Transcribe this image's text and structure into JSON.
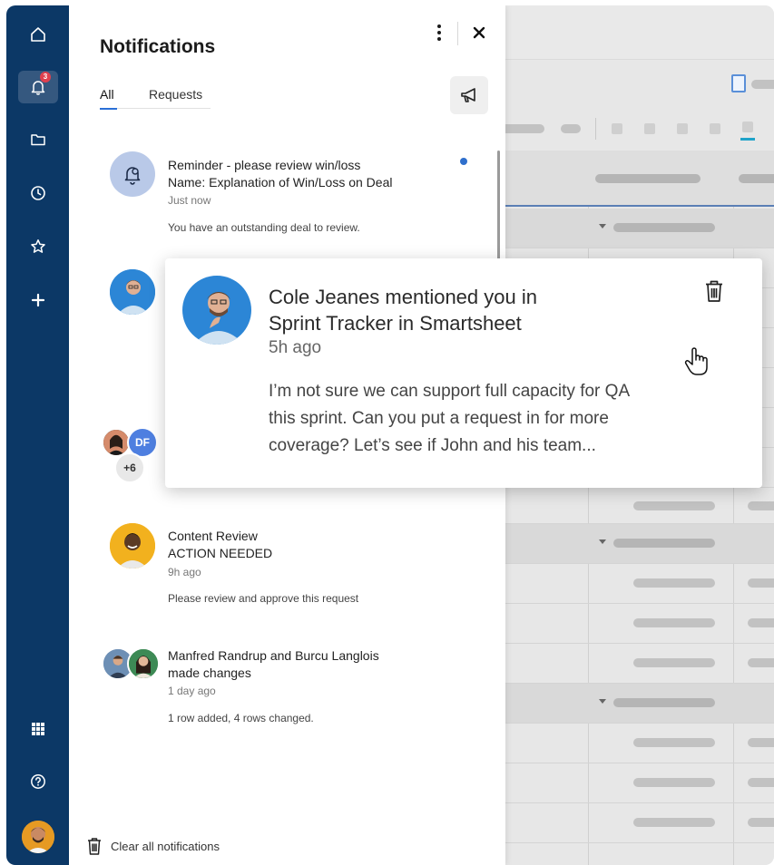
{
  "nav": {
    "items": [
      {
        "name": "home",
        "icon": "home-icon"
      },
      {
        "name": "notifications",
        "icon": "bell-icon",
        "badge": "3",
        "active": true
      },
      {
        "name": "browse",
        "icon": "folder-icon"
      },
      {
        "name": "recents",
        "icon": "clock-icon"
      },
      {
        "name": "favorites",
        "icon": "star-icon"
      },
      {
        "name": "create",
        "icon": "plus-icon"
      },
      {
        "name": "launcher",
        "icon": "grid-icon"
      },
      {
        "name": "help",
        "icon": "help-icon"
      }
    ],
    "badge_count": "3",
    "colors": {
      "rail": "#0c3866",
      "active": "#35587f",
      "badge": "#e0414f"
    }
  },
  "panel": {
    "title": "Notifications",
    "tabs": [
      {
        "label": "All",
        "active": true
      },
      {
        "label": "Requests",
        "active": false
      }
    ],
    "notifications": [
      {
        "title_line1": "Reminder - please review win/loss",
        "title_line2": "Name: Explanation of Win/Loss on Deal",
        "time": "Just now",
        "body": "You have an outstanding deal to review.",
        "unread": true,
        "icon": "reminder-bell-icon"
      },
      {
        "title_line1": "Content Review",
        "title_line2": "ACTION NEEDED",
        "time": "9h ago",
        "body": "Please review and approve this request"
      },
      {
        "title_line1": "Manfred Randrup and Burcu Langlois",
        "title_line2": "made changes",
        "time": "1 day ago",
        "body": "1 row added, 4 rows changed."
      }
    ],
    "group_avatar": {
      "initials": "DF",
      "more": "+6"
    },
    "clear_all": "Clear all notifications"
  },
  "hover_card": {
    "title_line1": "Cole Jeanes mentioned you in",
    "title_line2": "Sprint Tracker in Smartsheet",
    "time": "5h ago",
    "body_line1": "I’m not sure we can support full capacity for QA",
    "body_line2": "this sprint. Can you put a request in for more",
    "body_line3": "coverage? Let’s see if John and his team..."
  },
  "accent": "#2a6fd6"
}
